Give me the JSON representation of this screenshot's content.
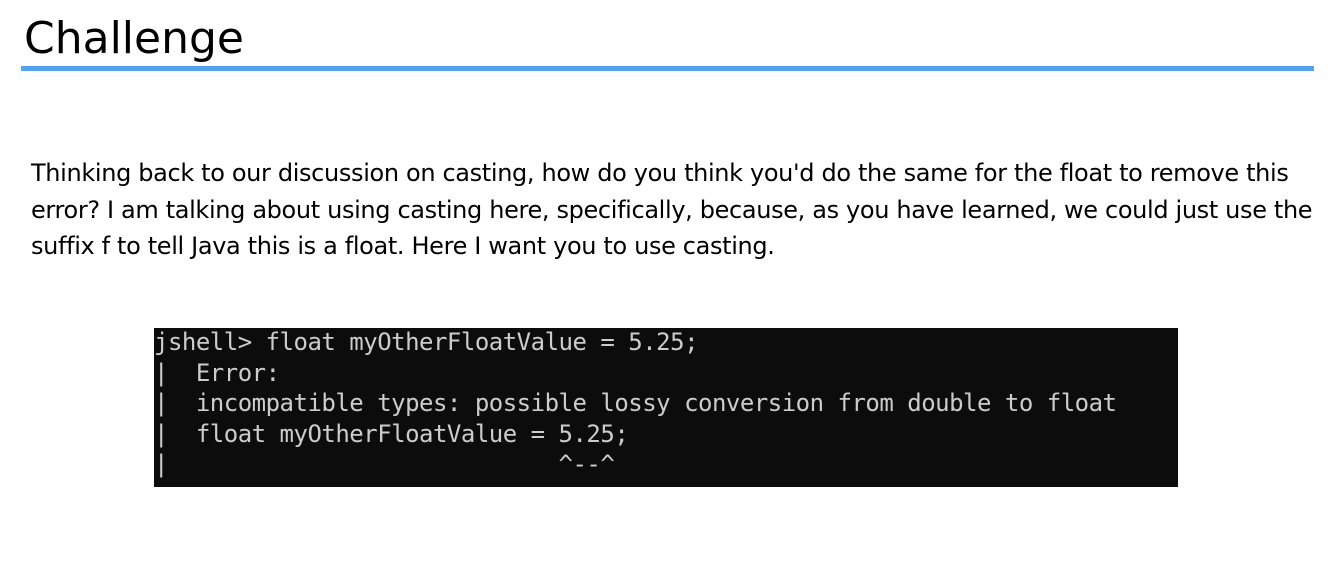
{
  "slide": {
    "title": "Challenge",
    "accent_color": "#54a3f0",
    "paragraph": "Thinking back to our discussion on casting, how do you think you'd do the same for the float to remove this error? I am talking about using casting here, specifically, because, as you have learned, we could just use the suffix f to tell Java this is a float. Here I want you to use casting."
  },
  "terminal": {
    "background_color": "#0c0c0c",
    "text_color": "#cccccc",
    "lines": [
      "jshell> float myOtherFloatValue = 5.25;",
      "|  Error:",
      "|  incompatible types: possible lossy conversion from double to float",
      "|  float myOtherFloatValue = 5.25;",
      "|                            ^--^"
    ]
  }
}
